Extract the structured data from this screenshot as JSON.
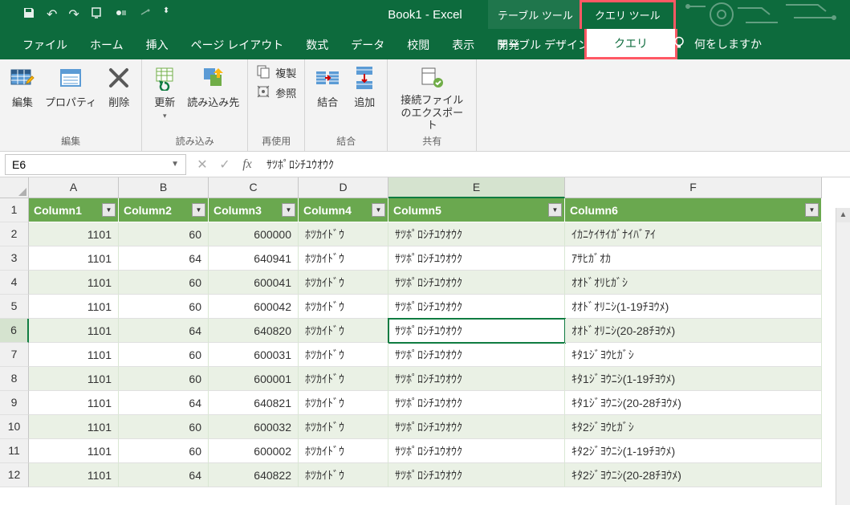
{
  "titlebar": {
    "title": "Book1  -  Excel",
    "context_tab1": "テーブル ツール",
    "context_tab2": "クエリ ツール"
  },
  "tabs": {
    "file": "ファイル",
    "home": "ホーム",
    "insert": "挿入",
    "pagelayout": "ページ レイアウト",
    "formulas": "数式",
    "data": "データ",
    "review": "校閲",
    "view": "表示",
    "developer": "開発",
    "table_design": "テーブル デザイン",
    "query": "クエリ",
    "tell_me": "何をしますか"
  },
  "ribbon": {
    "edit_group": "編集",
    "edit": "編集",
    "properties": "プロパティ",
    "delete": "削除",
    "load_group": "読み込み",
    "refresh": "更新",
    "load_to": "読み込み先",
    "reuse_group": "再使用",
    "duplicate": "複製",
    "reference": "参照",
    "combine_group": "結合",
    "merge": "結合",
    "append": "追加",
    "share_group": "共有",
    "export_conn": "接続ファイルのエクスポート"
  },
  "formula_bar": {
    "name_box": "E6",
    "formula": "ｻﾂﾎﾟﾛｼﾁﾕｳｵｳｸ"
  },
  "columns": [
    "A",
    "B",
    "C",
    "D",
    "E",
    "F"
  ],
  "headers": [
    "Column1",
    "Column2",
    "Column3",
    "Column4",
    "Column5",
    "Column6"
  ],
  "selected_cell": {
    "row": 6,
    "col": "E"
  },
  "rows": [
    {
      "n": 2,
      "c1": "1101",
      "c2": "60",
      "c3": "600000",
      "c4": "ﾎﾂｶｲﾄﾞｳ",
      "c5": "ｻﾂﾎﾟﾛｼﾁﾕｳｵｳｸ",
      "c6": "ｲｶﾆｹｲｻｲｶﾞﾅｲﾊﾞｱｲ"
    },
    {
      "n": 3,
      "c1": "1101",
      "c2": "64",
      "c3": "640941",
      "c4": "ﾎﾂｶｲﾄﾞｳ",
      "c5": "ｻﾂﾎﾟﾛｼﾁﾕｳｵｳｸ",
      "c6": "ｱｻﾋｶﾞｵｶ"
    },
    {
      "n": 4,
      "c1": "1101",
      "c2": "60",
      "c3": "600041",
      "c4": "ﾎﾂｶｲﾄﾞｳ",
      "c5": "ｻﾂﾎﾟﾛｼﾁﾕｳｵｳｸ",
      "c6": "ｵｵﾄﾞｵﾘﾋｶﾞｼ"
    },
    {
      "n": 5,
      "c1": "1101",
      "c2": "60",
      "c3": "600042",
      "c4": "ﾎﾂｶｲﾄﾞｳ",
      "c5": "ｻﾂﾎﾟﾛｼﾁﾕｳｵｳｸ",
      "c6": "ｵｵﾄﾞｵﾘﾆｼ(1-19ﾁﾖｳﾒ)"
    },
    {
      "n": 6,
      "c1": "1101",
      "c2": "64",
      "c3": "640820",
      "c4": "ﾎﾂｶｲﾄﾞｳ",
      "c5": "ｻﾂﾎﾟﾛｼﾁﾕｳｵｳｸ",
      "c6": "ｵｵﾄﾞｵﾘﾆｼ(20-28ﾁﾖｳﾒ)"
    },
    {
      "n": 7,
      "c1": "1101",
      "c2": "60",
      "c3": "600031",
      "c4": "ﾎﾂｶｲﾄﾞｳ",
      "c5": "ｻﾂﾎﾟﾛｼﾁﾕｳｵｳｸ",
      "c6": "ｷﾀ1ｼﾞﾖｳﾋｶﾞｼ"
    },
    {
      "n": 8,
      "c1": "1101",
      "c2": "60",
      "c3": "600001",
      "c4": "ﾎﾂｶｲﾄﾞｳ",
      "c5": "ｻﾂﾎﾟﾛｼﾁﾕｳｵｳｸ",
      "c6": "ｷﾀ1ｼﾞﾖｳﾆｼ(1-19ﾁﾖｳﾒ)"
    },
    {
      "n": 9,
      "c1": "1101",
      "c2": "64",
      "c3": "640821",
      "c4": "ﾎﾂｶｲﾄﾞｳ",
      "c5": "ｻﾂﾎﾟﾛｼﾁﾕｳｵｳｸ",
      "c6": "ｷﾀ1ｼﾞﾖｳﾆｼ(20-28ﾁﾖｳﾒ)"
    },
    {
      "n": 10,
      "c1": "1101",
      "c2": "60",
      "c3": "600032",
      "c4": "ﾎﾂｶｲﾄﾞｳ",
      "c5": "ｻﾂﾎﾟﾛｼﾁﾕｳｵｳｸ",
      "c6": "ｷﾀ2ｼﾞﾖｳﾋｶﾞｼ"
    },
    {
      "n": 11,
      "c1": "1101",
      "c2": "60",
      "c3": "600002",
      "c4": "ﾎﾂｶｲﾄﾞｳ",
      "c5": "ｻﾂﾎﾟﾛｼﾁﾕｳｵｳｸ",
      "c6": "ｷﾀ2ｼﾞﾖｳﾆｼ(1-19ﾁﾖｳﾒ)"
    },
    {
      "n": 12,
      "c1": "1101",
      "c2": "64",
      "c3": "640822",
      "c4": "ﾎﾂｶｲﾄﾞｳ",
      "c5": "ｻﾂﾎﾟﾛｼﾁﾕｳｵｳｸ",
      "c6": "ｷﾀ2ｼﾞﾖｳﾆｼ(20-28ﾁﾖｳﾒ)"
    }
  ]
}
